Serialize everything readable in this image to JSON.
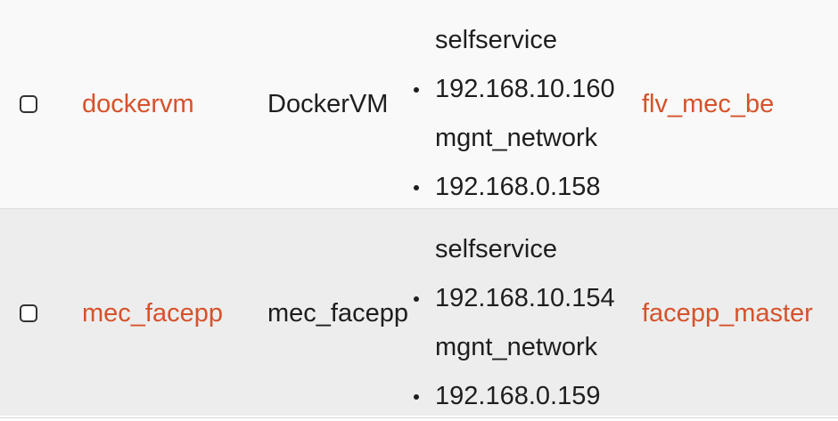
{
  "rows": [
    {
      "name": "dockervm",
      "image": "DockerVM",
      "networks": [
        {
          "label": "selfservice",
          "ip": "192.168.10.160"
        },
        {
          "label": "mgnt_network",
          "ip": "192.168.0.158"
        }
      ],
      "key_pair": "flv_mec_be"
    },
    {
      "name": "mec_facepp",
      "image": "mec_facepp",
      "networks": [
        {
          "label": "selfservice",
          "ip": "192.168.10.154"
        },
        {
          "label": "mgnt_network",
          "ip": "192.168.0.159"
        }
      ],
      "key_pair": "facepp_master"
    }
  ],
  "colors": {
    "link": "#d5522b",
    "row_odd": "#f9f9f9",
    "row_even": "#ededed"
  }
}
